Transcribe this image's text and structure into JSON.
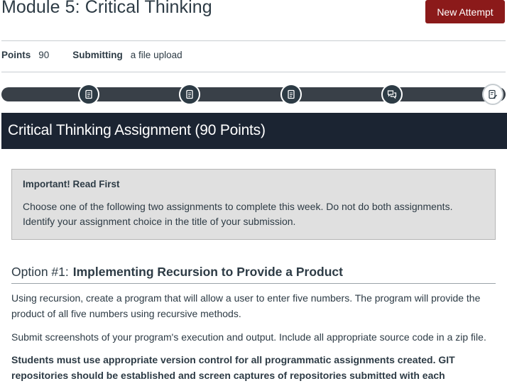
{
  "header": {
    "title": "Module 5: Critical Thinking",
    "new_attempt_label": "New Attempt"
  },
  "details": {
    "points_label": "Points",
    "points_value": "90",
    "submitting_label": "Submitting",
    "submitting_value": "a file upload"
  },
  "progress": {
    "steps": [
      {
        "icon": "document-icon"
      },
      {
        "icon": "document-icon"
      },
      {
        "icon": "document-icon"
      },
      {
        "icon": "discussion-icon"
      },
      {
        "icon": "assignment-edit-icon",
        "current": true
      }
    ]
  },
  "banner": {
    "title": "Critical Thinking Assignment (90 Points)"
  },
  "notice": {
    "title": "Important! Read First",
    "text": "Choose one of the following two assignments to complete this week. Do not do both assignments. Identify your assignment choice in the title of your submission."
  },
  "option1": {
    "prefix": "Option #1:",
    "title": "Implementing Recursion to Provide a Product",
    "paragraph1": "Using recursion, create a program that will allow a user to enter five numbers. The program will provide the product of all five numbers using recursive methods.",
    "paragraph2": "Submit screenshots of your program's execution and output. Include all appropriate source code in a zip file.",
    "paragraph3": "Students must use appropriate version control for all programmatic assignments created. GIT repositories should be established and screen captures of repositories submitted with each assignment."
  },
  "colors": {
    "accent_button": "#8b1a1a",
    "banner_bg": "#1b2432",
    "progress_bg": "#394048",
    "notice_bg": "#e0e0e0"
  }
}
